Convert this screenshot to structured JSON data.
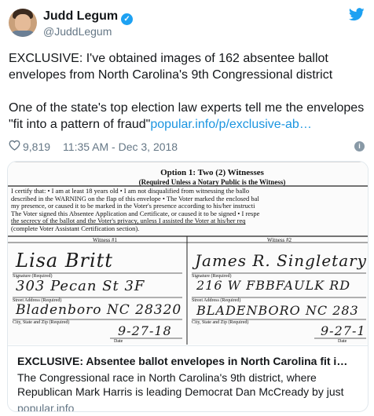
{
  "author": {
    "name": "Judd Legum",
    "handle": "@JuddLegum"
  },
  "tweet": {
    "paragraph1": "EXCLUSIVE: I've obtained images of 162 absentee ballot envelopes from North Carolina's 9th Congressional district",
    "paragraph2_text": "One of the state's top election law experts tell me the envelopes \"fit into a pattern of fraud\"",
    "paragraph2_link": "popular.info/p/exclusive-ab…"
  },
  "meta": {
    "likes": "9,819",
    "timestamp": "11:35 AM - Dec 3, 2018"
  },
  "card": {
    "title": "EXCLUSIVE: Absentee ballot envelopes in North Carolina fit i…",
    "description": "The Congressional race in North Carolina's 9th district, where Republican Mark Harris is leading Democrat Dan McCready by just",
    "domain": "popular.info",
    "image": {
      "header": "Option 1: Two (2) Witnesses",
      "subheader": "(Required Unless a Notary Public is the Witness)",
      "lines": [
        "I certify that: • I am at least 18 years old • I am not disqualified from witnessing the ballo",
        "described in the WARNING on the flap of this envelope • The Voter marked the enclosed bal",
        "my presence, or caused it to be marked in the Voter's presence according to his/her instructi",
        "The Voter signed this Absentee Application and Certificate, or caused it to be signed • I respe",
        "the secrecy of the ballot and the Voter's privacy, unless I assisted the Voter at his/her req",
        "(complete Voter Assistant Certification section)."
      ],
      "witness1_label": "Witness #1",
      "witness2_label": "Witness #2",
      "signature_label": "Signature (Required)",
      "street_label": "Street Address (Required)",
      "city_label": "City, State and Zip (Required)",
      "date_label": "Date",
      "w1_signature": "Lisa Britt",
      "w1_street": "303 Pecan St 3F",
      "w1_city": "Bladenboro NC 28320",
      "w1_date": "9-27-18",
      "w2_signature": "James R. Singletary",
      "w2_street": "216 W FBBFAULK RD",
      "w2_city": "BLADENBORO NC 283",
      "w2_date": "9-27-1"
    }
  }
}
